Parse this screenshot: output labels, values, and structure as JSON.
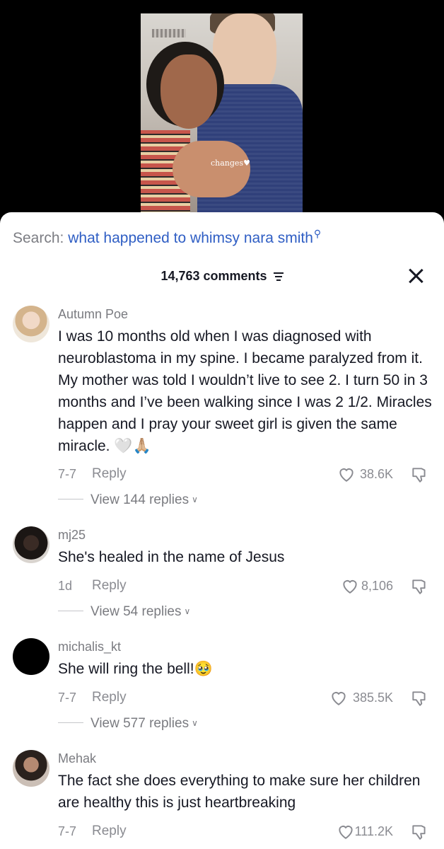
{
  "video": {
    "caption": "changes",
    "caption_icon": "white-heart"
  },
  "search": {
    "label": "Search:",
    "term": "what happened to whimsy nara smith",
    "icon": "search-icon"
  },
  "comments_header": {
    "count_label": "14,763 comments"
  },
  "comments": [
    {
      "username": "Autumn Poe",
      "text": "I was 10 months old when I was diagnosed with neuroblastoma in my spine. I became paralyzed from it. My mother was told I wouldn’t live to see 2. I turn 50 in 3 months and I’ve been walking since I was 2 1/2. Miracles happen and I pray your sweet girl is given the same miracle. 🤍🙏🏼",
      "date": "7-7",
      "reply_label": "Reply",
      "likes": "38.6K",
      "view_replies": "View 144 replies"
    },
    {
      "username": "mj25",
      "text": "She's healed in the name of Jesus",
      "date": "1d",
      "reply_label": "Reply",
      "likes": "8,106",
      "view_replies": "View 54 replies"
    },
    {
      "username": "michalis_kt",
      "text": "She will ring the bell!🥹",
      "date": "7-7",
      "reply_label": "Reply",
      "likes": "385.5K",
      "view_replies": "View 577 replies"
    },
    {
      "username": "Mehak",
      "text": "The fact she does everything to make sure her children are healthy this is just heartbreaking",
      "date": "7-7",
      "reply_label": "Reply",
      "likes": "111.2K"
    }
  ]
}
